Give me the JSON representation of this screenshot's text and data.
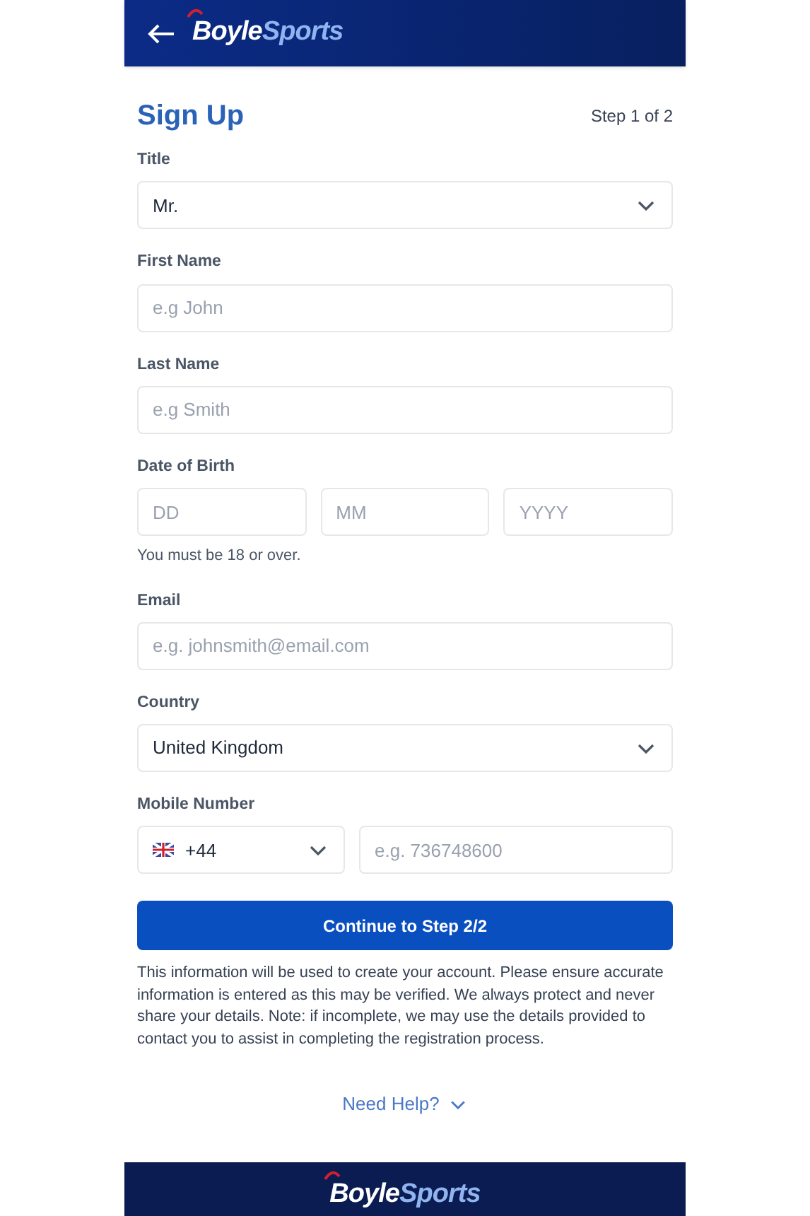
{
  "header": {
    "logo": [
      "Boyle",
      "Sports"
    ]
  },
  "title": "Sign Up",
  "step": "Step 1 of 2",
  "fields": [
    {
      "kind": "select",
      "label": "Title",
      "value": "Mr."
    },
    {
      "kind": "text",
      "label": "First Name",
      "placeholder": "e.g John"
    },
    {
      "kind": "text",
      "label": "Last Name",
      "placeholder": "e.g Smith"
    },
    {
      "kind": "date",
      "label": "Date of Birth",
      "parts": [
        {
          "placeholder": "DD"
        },
        {
          "placeholder": "MM"
        },
        {
          "placeholder": "YYYY"
        }
      ],
      "hint": "You must be 18 or over."
    },
    {
      "kind": "text",
      "label": "Email",
      "placeholder": "e.g. johnsmith@email.com"
    },
    {
      "kind": "select",
      "label": "Country",
      "value": "United Kingdom"
    },
    {
      "kind": "phone",
      "label": "Mobile Number",
      "code": "+44",
      "placeholder": "e.g. 736748600"
    }
  ],
  "button": "Continue to Step 2/2",
  "notice": "This information will be used to create your account. Please ensure accurate information is entered as this may be verified. We always protect and never share your details. Note: if incomplete, we may use the details provided to contact you to assist in completing the registration process.",
  "help": "Need Help?",
  "footer": {
    "logo": [
      "Boyle",
      "Sports"
    ]
  }
}
